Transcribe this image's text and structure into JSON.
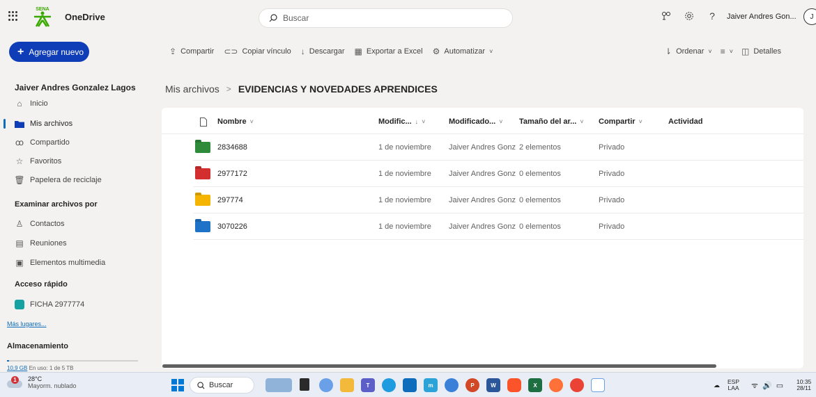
{
  "header": {
    "app_name": "OneDrive",
    "search_placeholder": "Buscar",
    "user_short": "Jaiver Andres Gon...",
    "avatar_initial": "J",
    "icons": [
      "app-launcher-icon",
      "diagram-icon",
      "settings-icon",
      "help-icon"
    ]
  },
  "sidebar": {
    "add_new": "Agregar nuevo",
    "user_name": "Jaiver Andres Gonzalez Lagos",
    "nav": [
      {
        "label": "Inicio",
        "icon": "home-icon"
      },
      {
        "label": "Mis archivos",
        "icon": "folder-icon",
        "active": true
      },
      {
        "label": "Compartido",
        "icon": "people-icon"
      },
      {
        "label": "Favoritos",
        "icon": "star-icon"
      },
      {
        "label": "Papelera de reciclaje",
        "icon": "trash-icon"
      }
    ],
    "browse_title": "Examinar archivos por",
    "browse": [
      {
        "label": "Contactos",
        "icon": "person-icon"
      },
      {
        "label": "Reuniones",
        "icon": "calendar-icon"
      },
      {
        "label": "Elementos multimedia",
        "icon": "image-icon"
      }
    ],
    "quick_title": "Acceso rápido",
    "quick": [
      {
        "label": "FICHA 2977774",
        "icon": "group-icon"
      }
    ],
    "more_places": "Más lugares...",
    "storage_title": "Almacenamiento",
    "storage_used": "10,9 GB",
    "storage_rest": "En uso: 1 de 5 TB",
    "storage_fraction": 0.0022
  },
  "commands": {
    "share": "Compartir",
    "copy_link": "Copiar vínculo",
    "download": "Descargar",
    "export_excel": "Exportar a Excel",
    "automate": "Automatizar",
    "sort": "Ordenar",
    "details": "Detalles"
  },
  "breadcrumb": {
    "root": "Mis archivos",
    "separator": ">",
    "current": "EVIDENCIAS Y NOVEDADES APRENDICES"
  },
  "list": {
    "columns": {
      "name": "Nombre",
      "modified": "Modific...",
      "modified_by": "Modificado...",
      "size": "Tamaño del ar...",
      "sharing": "Compartir",
      "activity": "Actividad"
    },
    "rows": [
      {
        "name": "2834688",
        "modified": "1 de noviembre",
        "modified_by": "Jaiver Andres Gonz",
        "size": "2 elementos",
        "sharing": "Privado",
        "color": "#2e8b3a"
      },
      {
        "name": "2977172",
        "modified": "1 de noviembre",
        "modified_by": "Jaiver Andres Gonz",
        "size": "0 elementos",
        "sharing": "Privado",
        "color": "#d32f2f"
      },
      {
        "name": "297774",
        "modified": "1 de noviembre",
        "modified_by": "Jaiver Andres Gonz",
        "size": "0 elementos",
        "sharing": "Privado",
        "color": "#f4b400"
      },
      {
        "name": "3070226",
        "modified": "1 de noviembre",
        "modified_by": "Jaiver Andres Gonz",
        "size": "0 elementos",
        "sharing": "Privado",
        "color": "#1e73c8"
      }
    ]
  },
  "taskbar": {
    "weather_badge": "1",
    "temp": "28°C",
    "weather_desc": "Mayorm. nublado",
    "search": "Buscar",
    "lang_top": "ESP",
    "lang_bottom": "LAA",
    "time": "10:35",
    "date": "28/11"
  },
  "colors": {
    "accent": "#0f3db8",
    "link": "#0f6cbd"
  }
}
